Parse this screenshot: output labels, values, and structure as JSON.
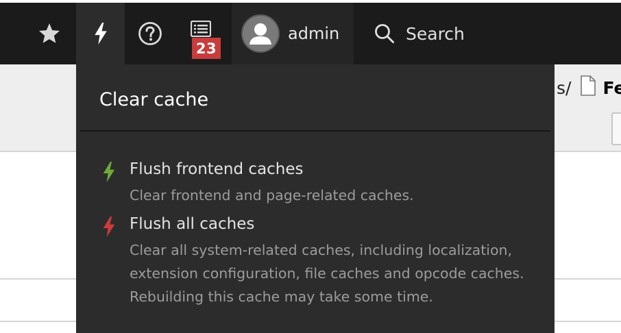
{
  "toolbar": {
    "bookmark_icon": "star-icon",
    "cache_icon": "bolt-icon",
    "help_icon": "question-circle-icon",
    "system_icon": "list-icon",
    "system_badge": "23",
    "user": {
      "avatar_icon": "user-avatar-icon",
      "name": "admin"
    },
    "search": {
      "icon": "search-icon",
      "label": "Search"
    }
  },
  "docheader": {
    "path_partial": "s/",
    "file_icon": "file-icon",
    "page_title_partial": "Fe"
  },
  "cache_menu": {
    "title": "Clear cache",
    "items": [
      {
        "icon": "bolt-icon",
        "icon_color": "#6daa3a",
        "title": "Flush frontend caches",
        "description": "Clear frontend and page-related caches."
      },
      {
        "icon": "bolt-icon",
        "icon_color": "#d03b3b",
        "title": "Flush all caches",
        "description": "Clear all system-related caches, including localization, extension configuration, file caches and opcode caches. Rebuilding this cache may take some time."
      }
    ]
  },
  "colors": {
    "toolbar_bg": "#1b1b1b",
    "menu_bg": "#2c2c2c",
    "badge_bg": "#c83c3c"
  }
}
